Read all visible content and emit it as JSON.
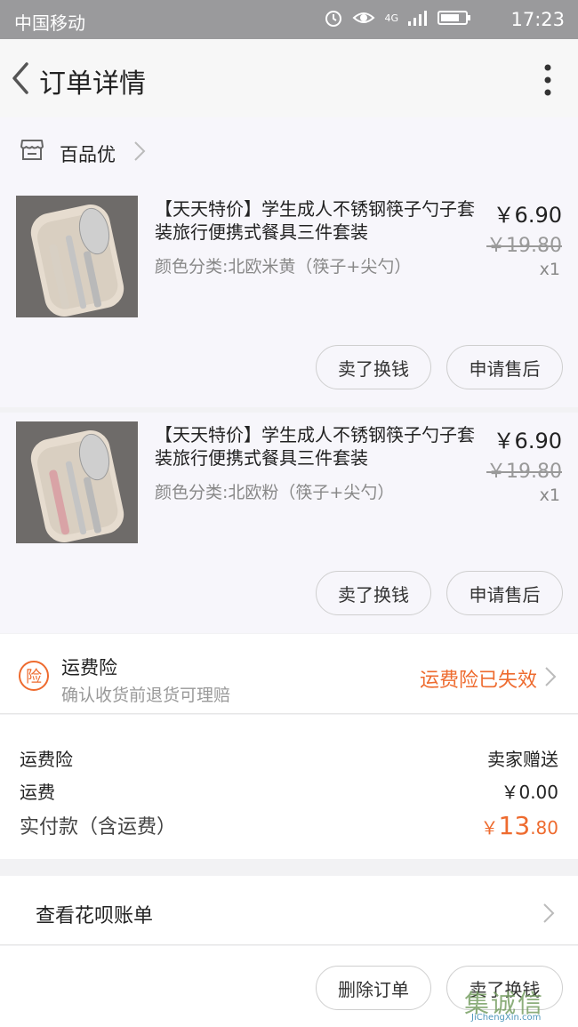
{
  "status_bar": {
    "carrier": "中国移动",
    "network": "4G",
    "time": "17:23"
  },
  "header": {
    "title": "订单详情"
  },
  "shop": {
    "name": "百品优"
  },
  "items": [
    {
      "name": "【天天特价】学生成人不锈钢筷子勺子套装旅行便携式餐具三件套装",
      "sku": "颜色分类:北欧米黄（筷子+尖勺）",
      "price": "￥6.90",
      "original_price": "￥19.80",
      "quantity": "x1",
      "buttons": {
        "sell": "卖了换钱",
        "after_sale": "申请售后"
      },
      "handle_color": "#d8d0c4"
    },
    {
      "name": "【天天特价】学生成人不锈钢筷子勺子套装旅行便携式餐具三件套装",
      "sku": "颜色分类:北欧粉（筷子+尖勺）",
      "price": "￥6.90",
      "original_price": "￥19.80",
      "quantity": "x1",
      "buttons": {
        "sell": "卖了换钱",
        "after_sale": "申请售后"
      },
      "handle_color": "#d9a3a6"
    }
  ],
  "insurance": {
    "badge": "险",
    "title": "运费险",
    "subtitle": "确认收货前退货可理赔",
    "status": "运费险已失效"
  },
  "costs": {
    "shipping_insurance_label": "运费险",
    "shipping_insurance_value": "卖家赠送",
    "shipping_label": "运费",
    "shipping_value": "￥0.00",
    "total_label": "实付款（含运费）",
    "total_currency": "￥",
    "total_integer": "13",
    "total_decimal": ".80"
  },
  "bill": {
    "label": "查看花呗账单"
  },
  "actions": {
    "delete": "删除订单",
    "sell": "卖了换钱"
  },
  "watermark": {
    "main": "集诚信",
    "sub": "JiChengXin.com"
  },
  "colors": {
    "accent": "#ee6b2f",
    "status_bar": "#9a9a9c"
  }
}
